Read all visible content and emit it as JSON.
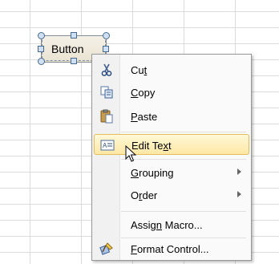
{
  "form_button": {
    "label": "Button"
  },
  "menu": {
    "items": [
      {
        "pre": "Cu",
        "u": "t",
        "post": "",
        "icon": "scissors-icon"
      },
      {
        "pre": "",
        "u": "C",
        "post": "opy",
        "icon": "copy-icon"
      },
      {
        "pre": "",
        "u": "P",
        "post": "aste",
        "icon": "paste-icon"
      },
      {
        "pre": "Edit Te",
        "u": "x",
        "post": "t",
        "icon": "edit-text-icon",
        "highlighted": true
      },
      {
        "pre": "",
        "u": "G",
        "post": "rouping",
        "submenu": true
      },
      {
        "pre": "O",
        "u": "r",
        "post": "der",
        "submenu": true
      },
      {
        "pre": "Assig",
        "u": "n",
        "post": " Macro...",
        "icon": ""
      },
      {
        "pre": "",
        "u": "F",
        "post": "ormat Control...",
        "icon": "format-control-icon"
      }
    ]
  },
  "colors": {
    "highlight_border": "#e3bd5c",
    "highlight_fill": "#fde8a4",
    "gridline": "#dadcdd"
  }
}
